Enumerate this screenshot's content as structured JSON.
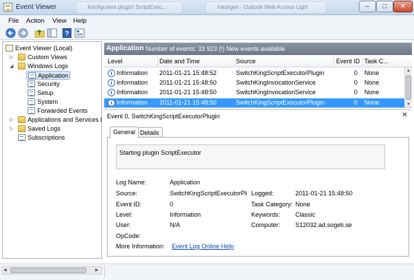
{
  "window": {
    "title": "Event Viewer",
    "background_tabs": [
      "Konfigurera plugin! ScriptExec...",
      "Inkorgen - Outlook Web Access Light"
    ],
    "controls": {
      "minimize": "–",
      "maximize": "□",
      "close": "✕"
    }
  },
  "menu": {
    "items": [
      "File",
      "Action",
      "View",
      "Help"
    ]
  },
  "toolbar": {
    "icons": [
      "back-arrow-icon",
      "forward-arrow-icon",
      "up-folder-icon",
      "show-hide-tree-icon",
      "help-icon",
      "properties-icon"
    ]
  },
  "tree": {
    "root": "Event Viewer (Local)",
    "items": [
      {
        "label": "Custom Views",
        "level": 1,
        "expander": "▷"
      },
      {
        "label": "Windows Logs",
        "level": 1,
        "expander": "◢"
      },
      {
        "label": "Application",
        "level": 2,
        "selected": true
      },
      {
        "label": "Security",
        "level": 2
      },
      {
        "label": "Setup",
        "level": 2
      },
      {
        "label": "System",
        "level": 2
      },
      {
        "label": "Forwarded Events",
        "level": 2
      },
      {
        "label": "Applications and Services Lo",
        "level": 1,
        "expander": "▷"
      },
      {
        "label": "Saved Logs",
        "level": 1,
        "expander": "▷"
      },
      {
        "label": "Subscriptions",
        "level": 1
      }
    ]
  },
  "list": {
    "log_name": "Application",
    "event_count_text": "Number of events: 33 923 (!) New events available",
    "columns": [
      "Level",
      "Date and Time",
      "Source",
      "Event ID",
      "Task C..."
    ],
    "rows": [
      {
        "level": "Information",
        "datetime": "2011-01-21 15:48:52",
        "source": "SwitchKingScriptExecutorPlugin",
        "event_id": "0",
        "task": "None"
      },
      {
        "level": "Information",
        "datetime": "2011-01-21 15:48:50",
        "source": "SwitchKingInvocationService",
        "event_id": "0",
        "task": "None"
      },
      {
        "level": "Information",
        "datetime": "2011-01-21 15:48:50",
        "source": "SwitchKingInvocationService",
        "event_id": "0",
        "task": "None"
      },
      {
        "level": "Information",
        "datetime": "2011-01-21 15:48:50",
        "source": "SwitchKingScriptExecutorPlugin",
        "event_id": "0",
        "task": "None",
        "selected": true
      }
    ]
  },
  "detail": {
    "title": "Event 0, SwitchKingScriptExecutorPlugin",
    "close": "✕",
    "tabs": [
      "General",
      "Details"
    ],
    "description": "Starting plugin ScriptExecutor",
    "fields": {
      "log_name_label": "Log Name:",
      "log_name": "Application",
      "source_label": "Source:",
      "source": "SwitchKingScriptExecutorPlu",
      "logged_label": "Logged:",
      "logged": "2011-01-21 15:48:50",
      "event_id_label": "Event ID:",
      "event_id": "0",
      "task_category_label": "Task Category:",
      "task_category": "None",
      "level_label": "Level:",
      "level": "Information",
      "keywords_label": "Keywords:",
      "keywords": "Classic",
      "user_label": "User:",
      "user": "N/A",
      "computer_label": "Computer:",
      "computer": "S12032.ad.sogeti.se",
      "opcode_label": "OpCode:",
      "more_info_label": "More Information:",
      "more_info_link": "Event Log Online Help"
    }
  },
  "colors": {
    "selection": "#3399ff",
    "header": "#7d8796",
    "link": "#0645ad"
  }
}
